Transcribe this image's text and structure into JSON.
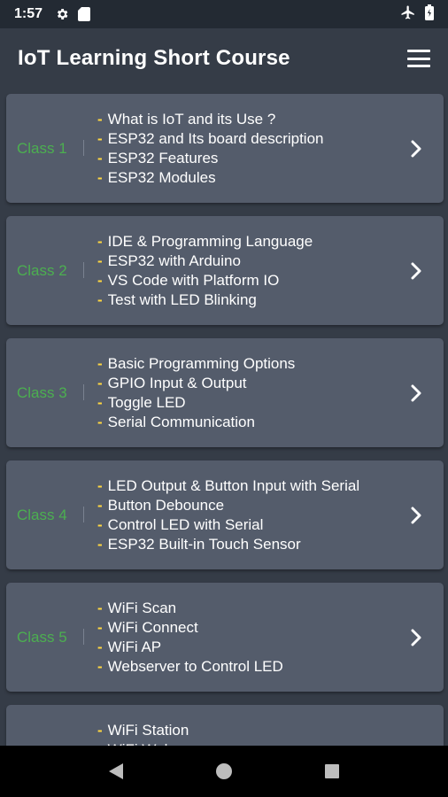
{
  "status": {
    "time": "1:57"
  },
  "app": {
    "title": "IoT Learning Short Course"
  },
  "classes": [
    {
      "label": "Class 1",
      "topics": [
        "What is IoT and its Use ?",
        "ESP32 and Its board description",
        "ESP32 Features",
        "ESP32 Modules"
      ]
    },
    {
      "label": "Class 2",
      "topics": [
        "IDE & Programming Language",
        "ESP32 with Arduino",
        "VS Code with Platform IO",
        "Test with LED Blinking"
      ]
    },
    {
      "label": "Class 3",
      "topics": [
        "Basic Programming Options",
        "GPIO Input & Output",
        "Toggle LED",
        "Serial Communication"
      ]
    },
    {
      "label": "Class 4",
      "topics": [
        "LED Output & Button Input with Serial",
        "Button Debounce",
        "Control LED with Serial",
        "ESP32 Built-in Touch Sensor"
      ]
    },
    {
      "label": "Class 5",
      "topics": [
        "WiFi Scan",
        "WiFi Connect",
        "WiFi AP",
        "Webserver to Control LED"
      ]
    },
    {
      "label": "",
      "topics": [
        "WiFi Station",
        "WiFi Web"
      ]
    }
  ],
  "colors": {
    "class_label": "#4caf50",
    "bullet": "#ffd740",
    "card": "#545c6b",
    "background": "#353c47"
  },
  "icons": {
    "settings": "gear-icon",
    "sd": "sd-card-icon",
    "airplane": "airplane-icon",
    "battery": "battery-icon",
    "menu": "hamburger-menu-icon",
    "chevron": "chevron-right-icon"
  }
}
